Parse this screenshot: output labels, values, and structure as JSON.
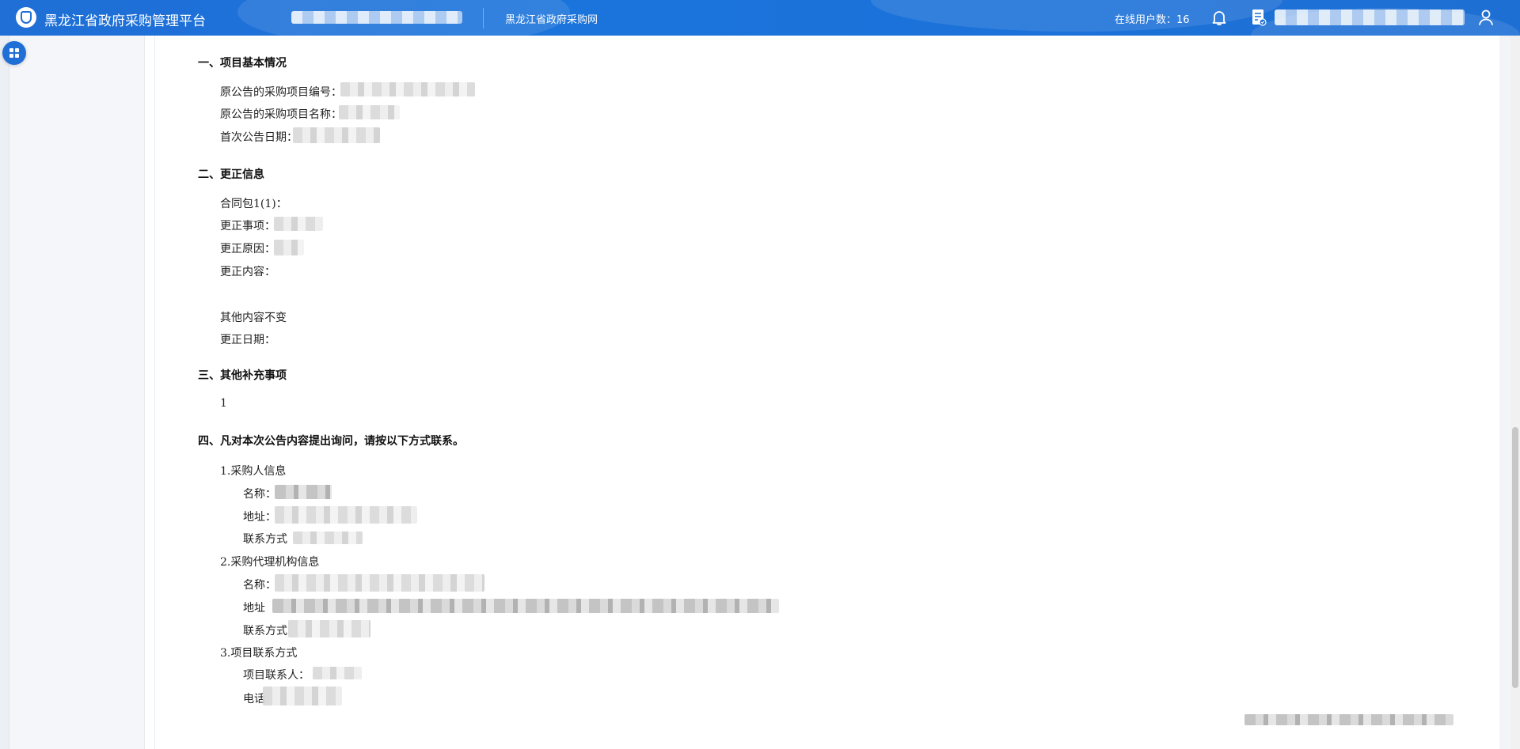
{
  "header": {
    "app_title": "黑龙江省政府采购管理平台",
    "link": "黑龙江省政府采购网",
    "online_users": "在线用户数：16"
  },
  "sections": {
    "s1": {
      "title": "一、项目基本情况",
      "orig_no_label": "原公告的采购项目编号：",
      "orig_name_label": "原公告的采购项目名称：",
      "first_date_label": "首次公告日期："
    },
    "s2": {
      "title": "二、更正信息",
      "package": "合同包1(1)：",
      "item": "更正事项：",
      "reason": "更正原因：",
      "content": "更正内容：",
      "unchanged": "其他内容不变",
      "date": "更正日期："
    },
    "s3": {
      "title": "三、其他补充事项",
      "value": "1"
    },
    "s4": {
      "title": "四、凡对本次公告内容提出询问，请按以下方式联系。",
      "buyer": "1.采购人信息",
      "buyer_name": "名称：",
      "buyer_address": "地址：",
      "buyer_contact": "联系方式",
      "agency": "2.采购代理机构信息",
      "agency_name": "名称：",
      "agency_address": "地址",
      "agency_contact": "联系方式",
      "project": "3.项目联系方式",
      "project_contact": "项目联系人：",
      "phone": "电话"
    }
  },
  "icons": [
    "shield-logo-icon",
    "bell-icon",
    "document-check-icon",
    "user-icon",
    "grid-menu-icon"
  ],
  "colors": {
    "header": "#1f6fd6",
    "accent": "#1f6fd6"
  }
}
